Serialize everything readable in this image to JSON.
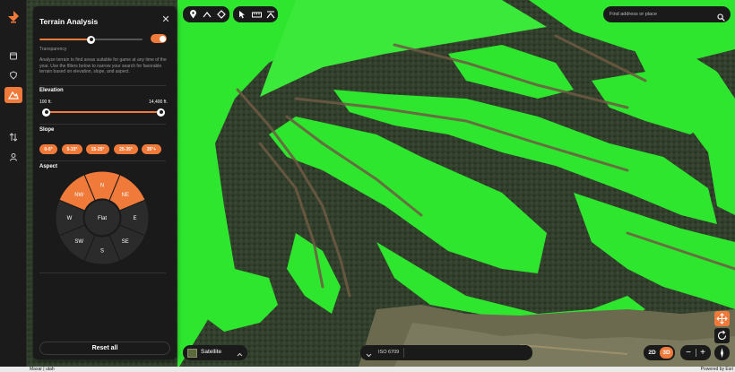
{
  "panel": {
    "title": "Terrain Analysis",
    "transparency_label": "Transparency",
    "transparency_value_percent": 45,
    "overlay_enabled": true,
    "description": "Analyze terrain to find areas suitable for game at any time of the year. Use the filters below to narrow your search for favorable terrain based on elevation, slope, and aspect.",
    "elevation": {
      "title": "Elevation",
      "min_label": "100 ft.",
      "max_label": "14,400 ft."
    },
    "slope": {
      "title": "Slope",
      "options": [
        "0-5°",
        "5-15°",
        "15-25°",
        "25-35°",
        "35°+"
      ]
    },
    "aspect": {
      "title": "Aspect",
      "directions": [
        "N",
        "NE",
        "E",
        "SE",
        "S",
        "SW",
        "W",
        "NW"
      ],
      "selected": [
        "N",
        "NE",
        "NW"
      ],
      "center_label": "Flat"
    },
    "reset_label": "Reset all"
  },
  "search": {
    "placeholder": "Find address or place"
  },
  "basemap": {
    "label": "Satellite"
  },
  "iso": {
    "label": "ISO 6709"
  },
  "view_mode": {
    "option_2d": "2D",
    "option_3d": "3D",
    "selected": "3D"
  },
  "footer": {
    "attribution_left": "Maxar | utah",
    "attribution_right": "Powered by Esri"
  },
  "colors": {
    "accent": "#f07a3a",
    "panel_bg": "#1a1a1a",
    "overlay_green": "#2ee62e"
  }
}
